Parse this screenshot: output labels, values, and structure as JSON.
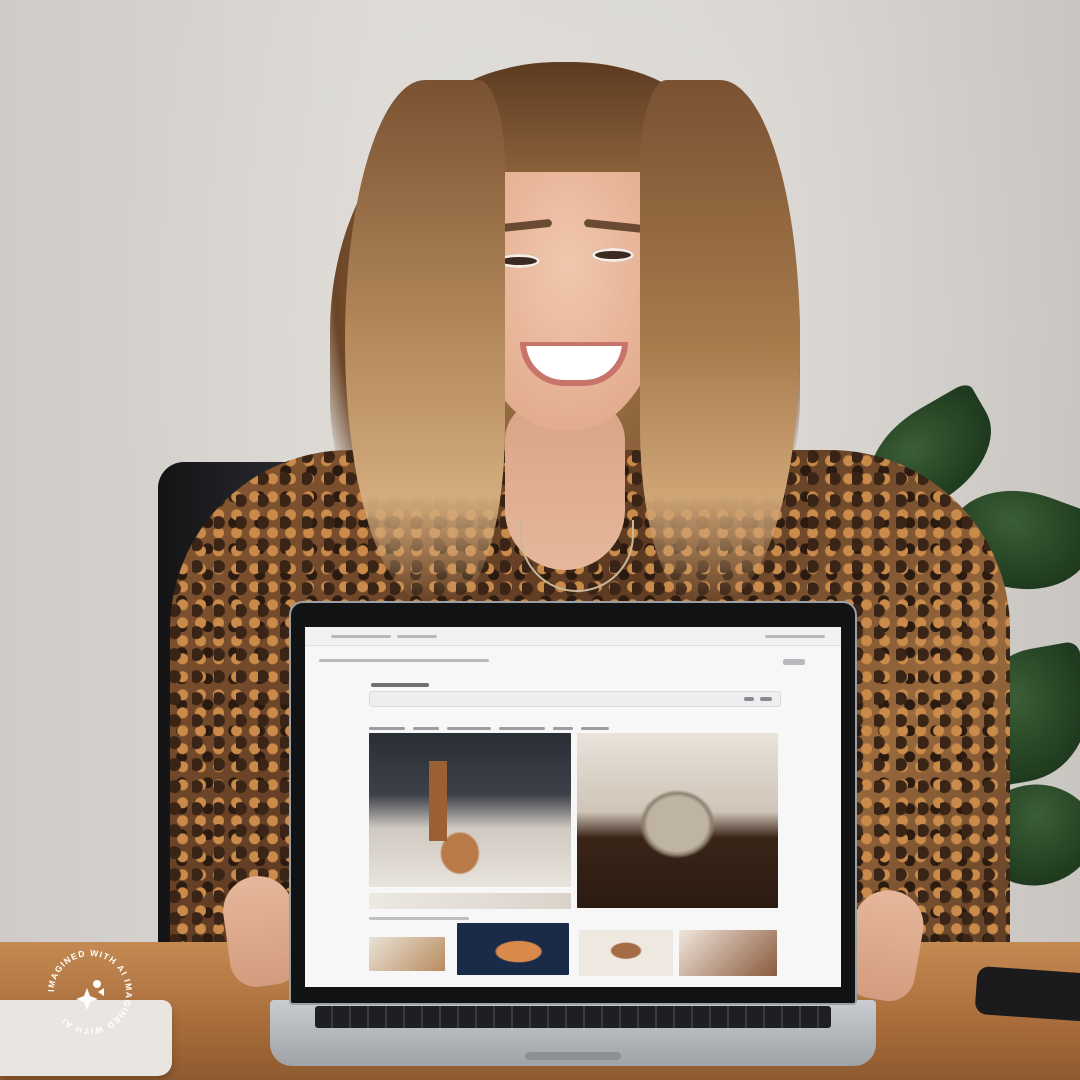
{
  "watermark": {
    "ring_text": "IMAGINED WITH AI  IMAGINED WITH AI  ",
    "icon": "sparkle-icon"
  },
  "laptop_screen": {
    "type": "photo-gallery website (text illegible)",
    "tiles": [
      "interior-photo",
      "interior-photo",
      "interior-photo",
      "food-photo",
      "food-photo",
      "interior-photo",
      "interior-photo"
    ]
  },
  "colors": {
    "wall": "#d9d6d1",
    "table": "#b57844",
    "blouse": "#7a4e2d",
    "hair": "#a87b4f",
    "laptop_bezel": "#111214"
  }
}
